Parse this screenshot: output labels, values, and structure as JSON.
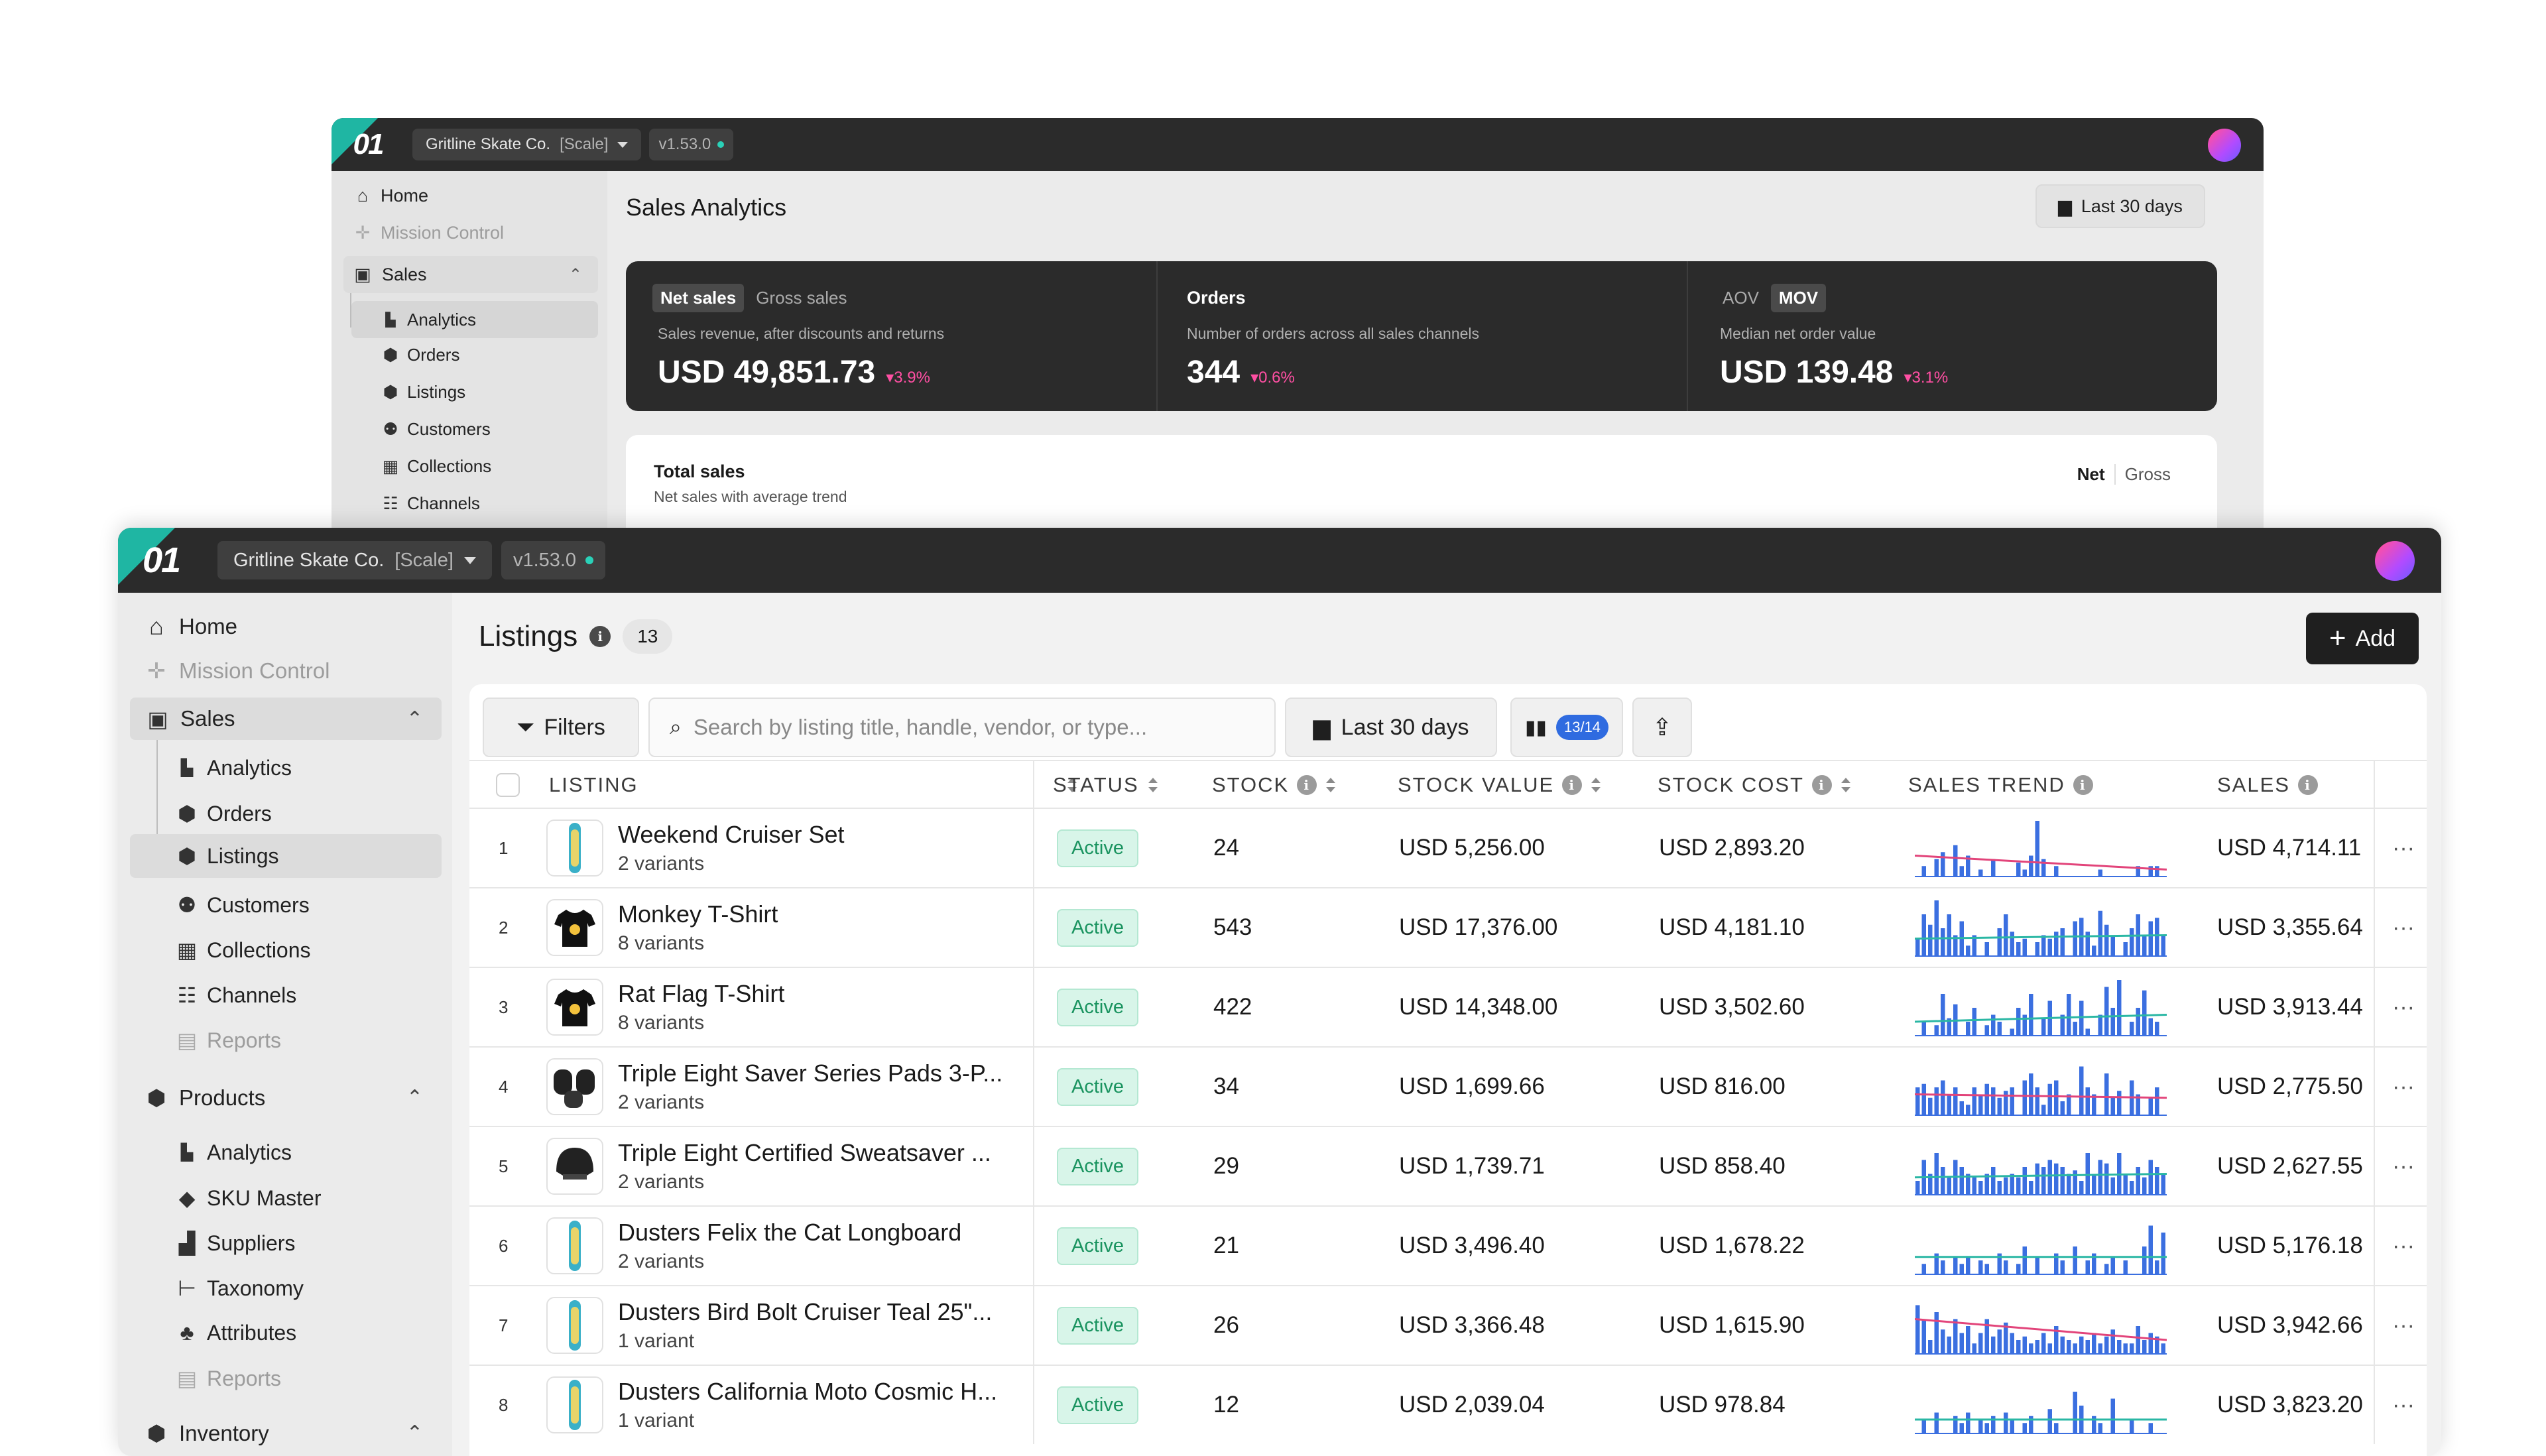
{
  "back": {
    "logo": "01",
    "workspace": "Gritline Skate Co.",
    "plan": "[Scale]",
    "version": "v1.53.0",
    "title": "Sales Analytics",
    "date_range": "Last 30 days",
    "nav": {
      "home": "Home",
      "mission": "Mission Control",
      "sales": "Sales",
      "analytics": "Analytics",
      "orders": "Orders",
      "listings": "Listings",
      "customers": "Customers",
      "collections": "Collections",
      "channels": "Channels"
    },
    "kpis": [
      {
        "tab_a": "Net sales",
        "tab_b": "Gross sales",
        "desc": "Sales revenue, after discounts and returns",
        "value": "USD 49,851.73",
        "delta": "3.9%"
      },
      {
        "title": "Orders",
        "desc": "Number of orders across all sales channels",
        "value": "344",
        "delta": "0.6%"
      },
      {
        "tab_a": "AOV",
        "tab_b": "MOV",
        "desc": "Median net order value",
        "value": "USD 139.48",
        "delta": "3.1%"
      }
    ],
    "total_sales": {
      "title": "Total sales",
      "subtitle": "Net sales with average trend",
      "toggle_a": "Net",
      "toggle_b": "Gross"
    }
  },
  "front": {
    "logo": "01",
    "workspace": "Gritline Skate Co.",
    "plan": "[Scale]",
    "version": "v1.53.0",
    "page_title": "Listings",
    "count": "13",
    "add_label": "Add",
    "filters_label": "Filters",
    "search_placeholder": "Search by listing title, handle, vendor, or type...",
    "date_range": "Last 30 days",
    "columns_badge": "13/14",
    "nav": {
      "home": "Home",
      "mission": "Mission Control",
      "sales": "Sales",
      "analytics": "Analytics",
      "orders": "Orders",
      "listings": "Listings",
      "customers": "Customers",
      "collections": "Collections",
      "channels": "Channels",
      "reports": "Reports",
      "products": "Products",
      "p_analytics": "Analytics",
      "sku": "SKU Master",
      "suppliers": "Suppliers",
      "taxonomy": "Taxonomy",
      "attributes": "Attributes",
      "p_reports": "Reports",
      "inventory": "Inventory"
    },
    "headers": {
      "listing": "LISTING",
      "status": "STATUS",
      "stock": "STOCK",
      "stock_value": "STOCK VALUE",
      "stock_cost": "STOCK COST",
      "sales_trend": "SALES TREND",
      "sales": "SALES"
    },
    "rows": [
      {
        "n": "1",
        "title": "Weekend Cruiser Set",
        "variants": "2 variants",
        "status": "Active",
        "stock": "24",
        "value": "USD 5,256.00",
        "cost": "USD 2,893.20",
        "sales": "USD 4,714.11",
        "thumb": "board-icon",
        "spark": [
          0,
          3,
          0,
          5,
          7,
          0,
          9,
          3,
          6,
          0,
          2,
          0,
          5,
          0,
          0,
          0,
          4,
          2,
          6,
          16,
          5,
          0,
          3,
          0,
          0,
          0,
          0,
          0,
          0,
          2,
          0,
          0,
          0,
          0,
          0,
          3,
          0,
          3,
          3,
          0
        ],
        "trend": [
          6,
          2
        ]
      },
      {
        "n": "2",
        "title": "Monkey T-Shirt",
        "variants": "8 variants",
        "status": "Active",
        "stock": "543",
        "value": "USD 17,376.00",
        "cost": "USD 4,181.10",
        "sales": "USD 3,355.64",
        "thumb": "tshirt-icon",
        "spark": [
          5,
          12,
          9,
          16,
          8,
          12,
          6,
          10,
          3,
          6,
          0,
          4,
          0,
          8,
          12,
          7,
          4,
          5,
          0,
          4,
          6,
          5,
          7,
          8,
          0,
          10,
          11,
          7,
          3,
          13,
          9,
          6,
          0,
          4,
          8,
          12,
          6,
          10,
          11,
          6
        ],
        "trend": [
          5,
          6
        ]
      },
      {
        "n": "3",
        "title": "Rat Flag T-Shirt",
        "variants": "8 variants",
        "status": "Active",
        "stock": "422",
        "value": "USD 14,348.00",
        "cost": "USD 3,502.60",
        "sales": "USD 3,913.44",
        "thumb": "tshirt-icon",
        "spark": [
          0,
          4,
          0,
          3,
          12,
          5,
          9,
          0,
          4,
          8,
          0,
          3,
          6,
          4,
          0,
          2,
          8,
          6,
          12,
          0,
          5,
          10,
          0,
          6,
          12,
          4,
          10,
          2,
          0,
          6,
          14,
          8,
          16,
          0,
          4,
          8,
          13,
          5,
          4,
          0
        ],
        "trend": [
          4,
          6
        ]
      },
      {
        "n": "4",
        "title": "Triple Eight Saver Series Pads 3-P...",
        "variants": "2 variants",
        "status": "Active",
        "stock": "34",
        "value": "USD 1,699.66",
        "cost": "USD 816.00",
        "sales": "USD 2,775.50",
        "thumb": "pads-icon",
        "spark": [
          8,
          9,
          5,
          8,
          10,
          6,
          8,
          4,
          3,
          8,
          6,
          9,
          8,
          5,
          7,
          8,
          0,
          10,
          12,
          8,
          3,
          9,
          10,
          4,
          6,
          0,
          14,
          8,
          6,
          0,
          12,
          5,
          7,
          0,
          10,
          6,
          0,
          5,
          8,
          0
        ],
        "trend": [
          6,
          5
        ]
      },
      {
        "n": "5",
        "title": "Triple Eight Certified Sweatsaver ...",
        "variants": "2 variants",
        "status": "Active",
        "stock": "29",
        "value": "USD 1,739.71",
        "cost": "USD 858.40",
        "sales": "USD 2,627.55",
        "thumb": "helmet-icon",
        "spark": [
          4,
          10,
          6,
          12,
          8,
          5,
          10,
          8,
          6,
          5,
          4,
          6,
          8,
          4,
          5,
          6,
          5,
          8,
          4,
          9,
          8,
          10,
          9,
          8,
          6,
          7,
          4,
          12,
          6,
          10,
          9,
          5,
          12,
          6,
          4,
          8,
          5,
          10,
          8,
          6
        ],
        "trend": [
          5,
          6
        ]
      },
      {
        "n": "6",
        "title": "Dusters Felix the Cat Longboard",
        "variants": "2 variants",
        "status": "Active",
        "stock": "21",
        "value": "USD 3,496.40",
        "cost": "USD 1,678.22",
        "sales": "USD 5,176.18",
        "thumb": "board-icon",
        "spark": [
          0,
          3,
          0,
          6,
          4,
          0,
          5,
          3,
          5,
          0,
          4,
          3,
          0,
          6,
          4,
          0,
          3,
          8,
          0,
          5,
          0,
          0,
          6,
          4,
          0,
          8,
          0,
          4,
          6,
          0,
          3,
          5,
          0,
          4,
          0,
          0,
          8,
          14,
          4,
          12
        ],
        "trend": [
          5,
          5
        ]
      },
      {
        "n": "7",
        "title": "Dusters Bird Bolt Cruiser Teal 25\"...",
        "variants": "1 variant",
        "status": "Active",
        "stock": "26",
        "value": "USD 3,366.48",
        "cost": "USD 1,615.90",
        "sales": "USD 3,942.66",
        "thumb": "board-icon",
        "spark": [
          14,
          10,
          4,
          12,
          7,
          5,
          10,
          6,
          8,
          3,
          6,
          10,
          5,
          7,
          9,
          6,
          4,
          5,
          3,
          4,
          6,
          3,
          8,
          5,
          4,
          3,
          5,
          4,
          6,
          3,
          5,
          7,
          4,
          3,
          3,
          8,
          4,
          6,
          5,
          3
        ],
        "trend": [
          10,
          4
        ]
      },
      {
        "n": "8",
        "title": "Dusters California Moto Cosmic H...",
        "variants": "1 variant",
        "status": "Active",
        "stock": "12",
        "value": "USD 2,039.04",
        "cost": "USD 978.84",
        "sales": "USD 3,823.20",
        "thumb": "board-icon",
        "spark": [
          0,
          4,
          0,
          6,
          0,
          0,
          5,
          3,
          6,
          0,
          4,
          3,
          5,
          0,
          6,
          4,
          0,
          3,
          5,
          0,
          0,
          7,
          3,
          0,
          0,
          12,
          8,
          0,
          5,
          3,
          0,
          10,
          0,
          0,
          4,
          0,
          0,
          3,
          0,
          0
        ],
        "trend": [
          4,
          4
        ]
      }
    ]
  },
  "colors": {
    "spark_bar": "#3b6fe0",
    "trend_down": "#e2447a",
    "trend_flat": "#2ab7a4",
    "delta": "#ff4fa3",
    "active_bg": "#d8f5e9",
    "active_fg": "#19935f"
  }
}
